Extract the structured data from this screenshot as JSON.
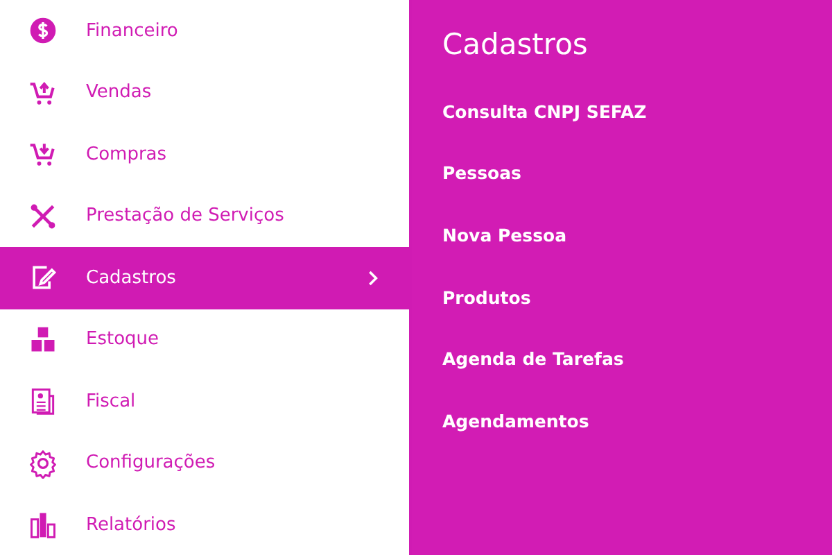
{
  "sidebar": {
    "items": [
      {
        "label": "Financeiro",
        "kind": "dollar",
        "selected": false
      },
      {
        "label": "Vendas",
        "kind": "cartup",
        "selected": false
      },
      {
        "label": "Compras",
        "kind": "cartdown",
        "selected": false
      },
      {
        "label": "Prestação de Serviços",
        "kind": "tools",
        "selected": false
      },
      {
        "label": "Cadastros",
        "kind": "edit",
        "selected": true
      },
      {
        "label": "Estoque",
        "kind": "boxes",
        "selected": false
      },
      {
        "label": "Fiscal",
        "kind": "document",
        "selected": false
      },
      {
        "label": "Configurações",
        "kind": "gear",
        "selected": false
      },
      {
        "label": "Relatórios",
        "kind": "bars",
        "selected": false
      }
    ]
  },
  "submenu": {
    "title": "Cadastros",
    "items": [
      "Consulta CNPJ SEFAZ",
      "Pessoas",
      "Nova Pessoa",
      "Produtos",
      "Agenda de Tarefas",
      "Agendamentos"
    ]
  }
}
